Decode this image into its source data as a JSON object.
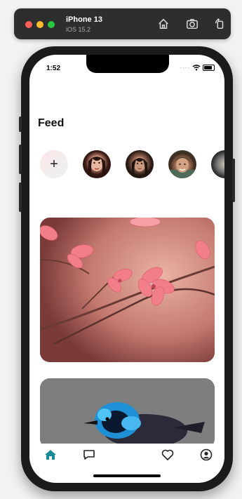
{
  "simulator": {
    "device_name": "iPhone 13",
    "os_version": "iOS 15.2",
    "icons": [
      "home-icon",
      "screenshot-icon",
      "rotate-icon"
    ]
  },
  "status_bar": {
    "time": "1:52"
  },
  "feed": {
    "title": "Feed",
    "stories": {
      "add_label": "+",
      "avatars": [
        "avatar-1",
        "avatar-2",
        "avatar-3",
        "avatar-4"
      ]
    },
    "posts": [
      {
        "name": "pink-blossom-photo"
      },
      {
        "name": "blue-bird-photo"
      }
    ]
  },
  "tab_bar": {
    "items": [
      {
        "name": "home",
        "active": true
      },
      {
        "name": "chat",
        "active": false
      },
      {
        "name": "heart",
        "active": false
      },
      {
        "name": "profile",
        "active": false
      }
    ],
    "active_color": "#1d8a99",
    "inactive_color": "#222222"
  }
}
